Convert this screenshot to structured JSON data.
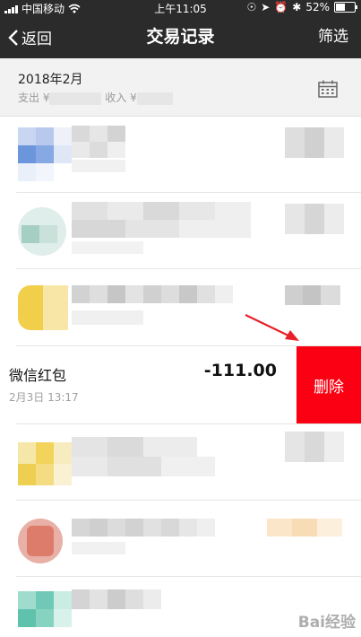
{
  "status_bar": {
    "carrier": "中国移动",
    "time": "上午11:05",
    "battery": "52%",
    "battery_level": 0.52
  },
  "nav": {
    "back_label": "返回",
    "title": "交易记录",
    "filter_label": "筛选"
  },
  "month": {
    "title": "2018年2月",
    "expense_label": "支出 ¥",
    "income_label": "收入 ¥"
  },
  "swiped_transaction": {
    "name": "微信红包",
    "date": "2月3日 13:17",
    "amount": "-111.00",
    "delete_label": "删除"
  },
  "colors": {
    "nav_bg": "#2b2b2b",
    "delete_red": "#fa0012",
    "annotation_arrow": "#e8202a"
  },
  "icons": {
    "back": "chevron-left-icon",
    "calendar": "calendar-icon",
    "wifi": "wifi-icon",
    "battery": "battery-icon"
  },
  "watermark": "Bai经验"
}
